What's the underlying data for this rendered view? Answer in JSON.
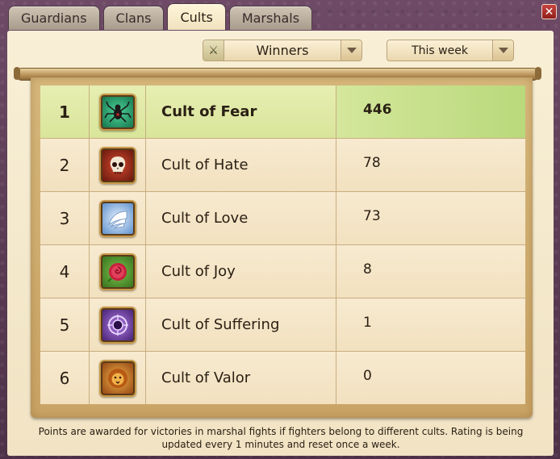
{
  "tabs": [
    {
      "label": "Guardians"
    },
    {
      "label": "Clans"
    },
    {
      "label": "Cults"
    },
    {
      "label": "Marshals"
    }
  ],
  "active_tab": "Cults",
  "close_label": "✕",
  "filters": {
    "category": {
      "value": "Winners",
      "icon": "crossed-swords-icon"
    },
    "period": {
      "value": "This week"
    }
  },
  "rows": [
    {
      "rank": "1",
      "name": "Cult of Fear",
      "score": "446",
      "icon": "spider-icon",
      "highlighted": true
    },
    {
      "rank": "2",
      "name": "Cult of Hate",
      "score": "78",
      "icon": "skull-icon"
    },
    {
      "rank": "3",
      "name": "Cult of Love",
      "score": "73",
      "icon": "wing-icon"
    },
    {
      "rank": "4",
      "name": "Cult of Joy",
      "score": "8",
      "icon": "rose-icon"
    },
    {
      "rank": "5",
      "name": "Cult of Suffering",
      "score": "1",
      "icon": "cage-icon"
    },
    {
      "rank": "6",
      "name": "Cult of Valor",
      "score": "0",
      "icon": "lion-icon"
    }
  ],
  "footer": {
    "text": "Points are awarded for victories in marshal fights if fighters belong to different cults. Rating is being updated every 1 minutes and reset once a week."
  }
}
